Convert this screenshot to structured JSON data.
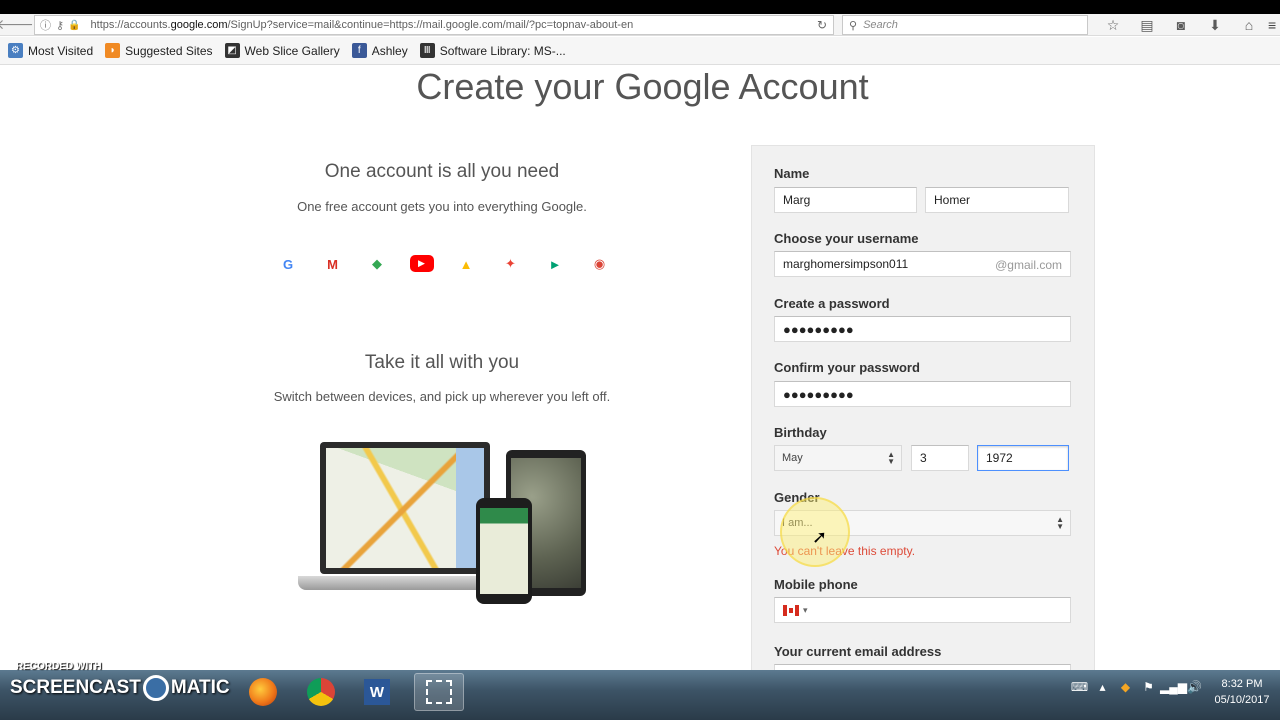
{
  "browser": {
    "url_prefix": "https://accounts.",
    "url_domain": "google.com",
    "url_rest": "/SignUp?service=mail&continue=https://mail.google.com/mail/?pc=topnav-about-en",
    "search_placeholder": "Search",
    "bookmarks": [
      {
        "label": "Most Visited",
        "icon": "gear-icon",
        "color": "#4a7fc1"
      },
      {
        "label": "Suggested Sites",
        "icon": "suggested-sites-icon",
        "color": "#f08a24"
      },
      {
        "label": "Web Slice Gallery",
        "icon": "web-slice-icon",
        "color": "#333333"
      },
      {
        "label": "Ashley",
        "icon": "facebook-icon",
        "color": "#3b5998"
      },
      {
        "label": "Software Library: MS-...",
        "icon": "library-icon",
        "color": "#333333"
      }
    ]
  },
  "page": {
    "title": "Create your Google Account",
    "left": {
      "heading1": "One account is all you need",
      "text1": "One free account gets you into everything Google.",
      "products": [
        {
          "name": "google-icon",
          "glyph": "G",
          "color": "#4285f4"
        },
        {
          "name": "gmail-icon",
          "glyph": "M",
          "color": "#d93025"
        },
        {
          "name": "maps-icon",
          "glyph": "◆",
          "color": "#34a853"
        },
        {
          "name": "youtube-icon",
          "glyph": "▶",
          "color": "#ff0000"
        },
        {
          "name": "drive-icon",
          "glyph": "▲",
          "color": "#fbbc04"
        },
        {
          "name": "photos-icon",
          "glyph": "✦",
          "color": "#ea4335"
        },
        {
          "name": "play-icon",
          "glyph": "►",
          "color": "#00a173"
        },
        {
          "name": "chrome-icon",
          "glyph": "◉",
          "color": "#db4437"
        }
      ],
      "heading2": "Take it all with you",
      "text2": "Switch between devices, and pick up wherever you left off."
    },
    "form": {
      "name_label": "Name",
      "first_name": "Marg",
      "last_name": "Homer",
      "username_label": "Choose your username",
      "username": "marghomersimpson011",
      "username_suffix": "@gmail.com",
      "password_label": "Create a password",
      "password_mask": "●●●●●●●●●",
      "confirm_label": "Confirm your password",
      "confirm_mask": "●●●●●●●●●",
      "birthday_label": "Birthday",
      "birth_month": "May",
      "birth_day": "3",
      "birth_year": "1972",
      "gender_label": "Gender",
      "gender_value": "I am...",
      "gender_error": "You can't leave this empty.",
      "phone_label": "Mobile phone",
      "phone_country": "▾",
      "email_label": "Your current email address"
    }
  },
  "taskbar": {
    "recorded_with": "RECORDED WITH",
    "logo_left": "SCREENCAST",
    "logo_right": "MATIC",
    "time": "8:32 PM",
    "date": "05/10/2017"
  }
}
